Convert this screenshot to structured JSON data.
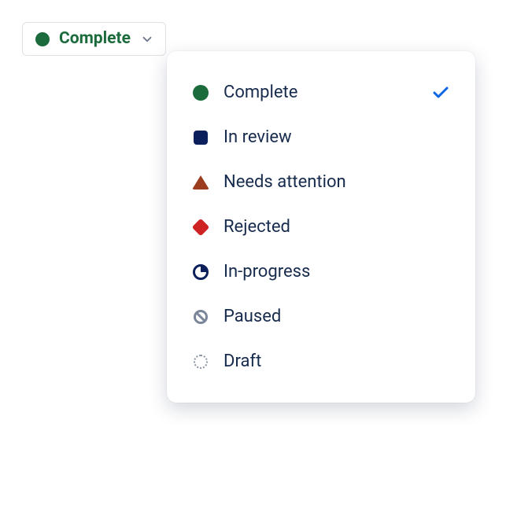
{
  "trigger": {
    "label": "Complete",
    "color": "#1B6B3C",
    "dot_color": "#1B6B3C"
  },
  "options": [
    {
      "label": "Complete",
      "icon": "circle-solid",
      "color": "#1B6B3C",
      "selected": true
    },
    {
      "label": "In review",
      "icon": "square-solid",
      "color": "#0B1F5C",
      "selected": false
    },
    {
      "label": "Needs attention",
      "icon": "triangle",
      "color": "#9C3D20",
      "selected": false
    },
    {
      "label": "Rejected",
      "icon": "diamond",
      "color": "#CE2323",
      "selected": false
    },
    {
      "label": "In-progress",
      "icon": "pie",
      "color": "#0B1F5C",
      "selected": false
    },
    {
      "label": "Paused",
      "icon": "slash-circle",
      "color": "#7A8699",
      "selected": false
    },
    {
      "label": "Draft",
      "icon": "dotted-circle",
      "color": "#8993A4",
      "selected": false
    }
  ]
}
